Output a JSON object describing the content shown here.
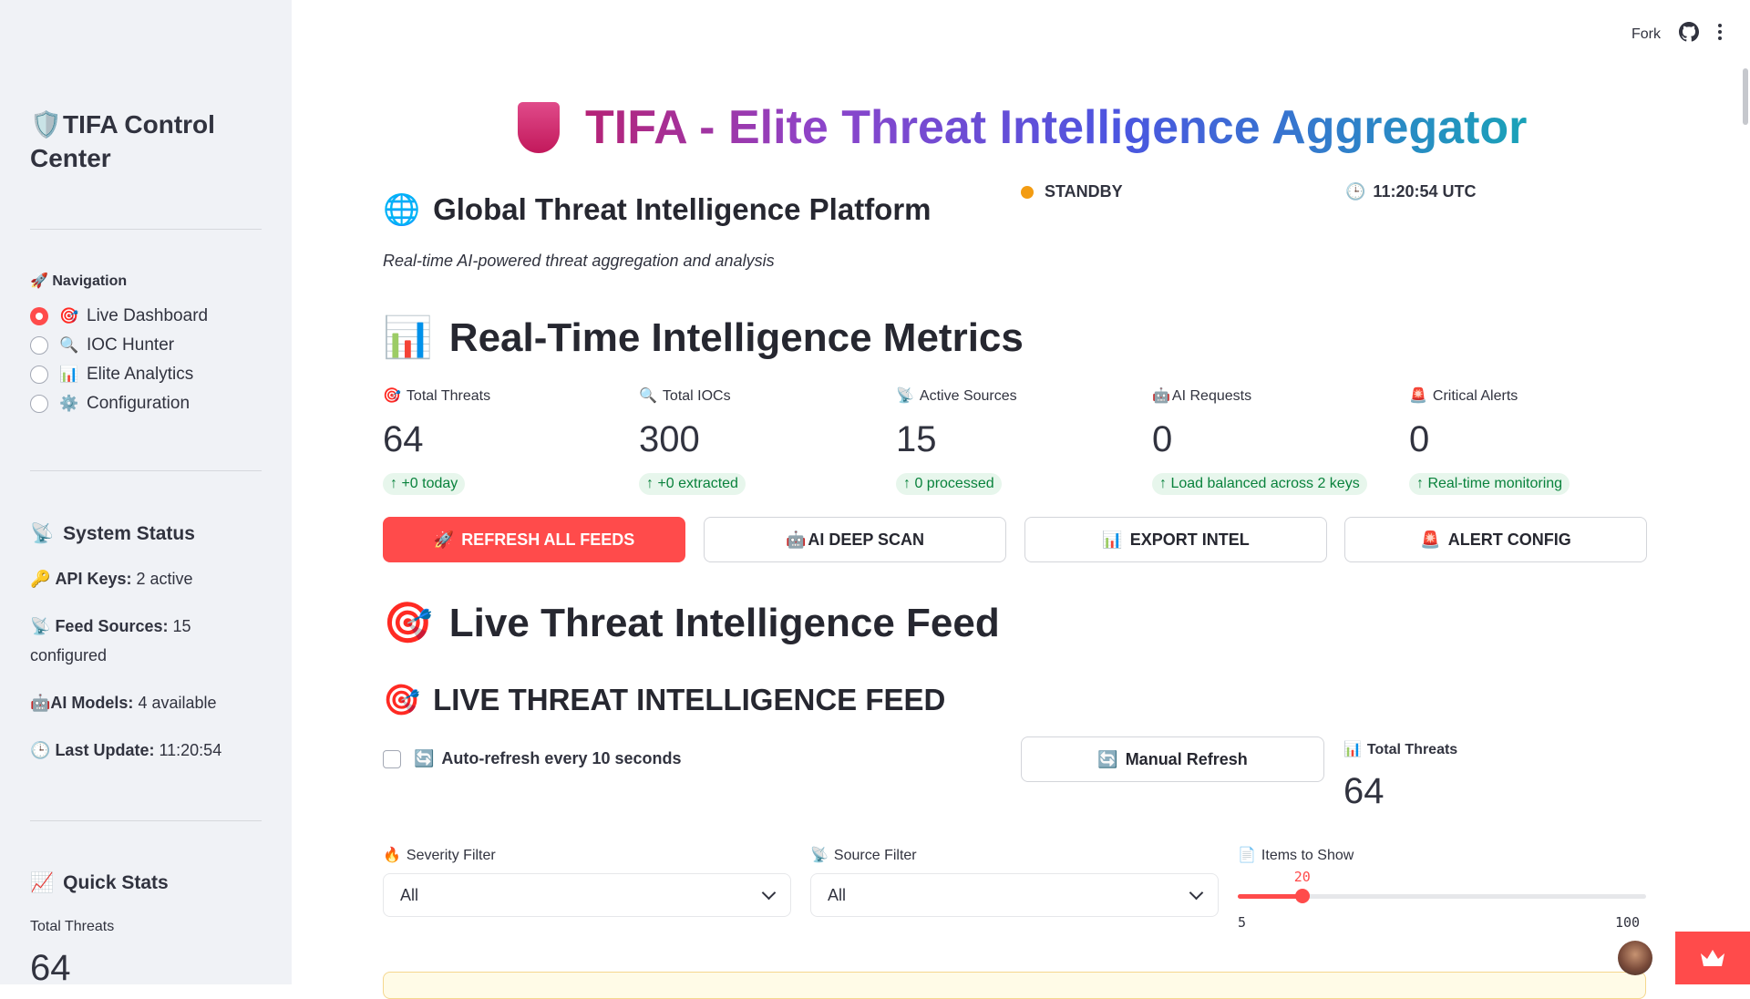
{
  "topbar": {
    "fork": "Fork",
    "github_icon": "github-icon",
    "menu_icon": "more-vertical-icon"
  },
  "sidebar": {
    "title_icon": "🛡️",
    "title": "TIFA Control Center",
    "nav_label": "🚀 Navigation",
    "nav_items": [
      {
        "icon": "🎯",
        "label": "Live Dashboard",
        "selected": true
      },
      {
        "icon": "🔍",
        "label": "IOC Hunter",
        "selected": false
      },
      {
        "icon": "📊",
        "label": "Elite Analytics",
        "selected": false
      },
      {
        "icon": "⚙️",
        "label": "Configuration",
        "selected": false
      }
    ],
    "system_status": {
      "icon": "📡",
      "title": "System Status",
      "api_keys_icon": "🔑",
      "api_keys_label": "API Keys:",
      "api_keys_value": "2 active",
      "feed_sources_icon": "📡",
      "feed_sources_label": "Feed Sources:",
      "feed_sources_value": "15 configured",
      "ai_models_icon": "🤖",
      "ai_models_label": "AI Models:",
      "ai_models_value": "4 available",
      "last_update_icon": "🕒",
      "last_update_label": "Last Update:",
      "last_update_value": "11:20:54"
    },
    "quick_stats": {
      "icon": "📈",
      "title": "Quick Stats",
      "total_threats_label": "Total Threats",
      "total_threats_value": "64"
    }
  },
  "main": {
    "title": "TIFA - Elite Threat Intelligence Aggregator",
    "platform_icon": "🌐",
    "platform_title": "Global Threat Intelligence Platform",
    "subtitle": "Real-time AI-powered threat aggregation and analysis",
    "status": "STANDBY",
    "status_color": "#f39c12",
    "clock_icon": "🕒",
    "clock": "11:20:54 UTC",
    "metrics_icon": "📊",
    "metrics_title": "Real-Time Intelligence Metrics",
    "metrics": [
      {
        "icon": "🎯",
        "label": "Total Threats",
        "value": "64",
        "delta": "+0 today"
      },
      {
        "icon": "🔍",
        "label": "Total IOCs",
        "value": "300",
        "delta": "+0 extracted"
      },
      {
        "icon": "📡",
        "label": "Active Sources",
        "value": "15",
        "delta": "0 processed"
      },
      {
        "icon": "🤖",
        "label": "AI Requests",
        "value": "0",
        "delta": "Load balanced across 2 keys"
      },
      {
        "icon": "🚨",
        "label": "Critical Alerts",
        "value": "0",
        "delta": "Real-time monitoring"
      }
    ],
    "buttons": [
      {
        "icon": "🚀",
        "label": "REFRESH ALL FEEDS"
      },
      {
        "icon": "🤖",
        "label": "AI DEEP SCAN"
      },
      {
        "icon": "📊",
        "label": "EXPORT INTEL"
      },
      {
        "icon": "🚨",
        "label": "ALERT CONFIG"
      }
    ],
    "feed_icon": "🎯",
    "feed_title": "Live Threat Intelligence Feed",
    "feed_subtitle": "LIVE THREAT INTELLIGENCE FEED",
    "auto_refresh_icon": "🔄",
    "auto_refresh_label": "Auto-refresh every 10 seconds",
    "manual_refresh_icon": "🔄",
    "manual_refresh_label": "Manual Refresh",
    "total_threats_icon": "📊",
    "total_threats_label": "Total Threats",
    "total_threats_value": "64",
    "severity_icon": "🔥",
    "severity_label": "Severity Filter",
    "severity_value": "All",
    "source_icon": "📡",
    "source_label": "Source Filter",
    "source_value": "All",
    "items_icon": "📄",
    "items_label": "Items to Show",
    "items_value": 20,
    "items_min": 5,
    "items_max": 100,
    "accent": "#ff4b4b"
  }
}
